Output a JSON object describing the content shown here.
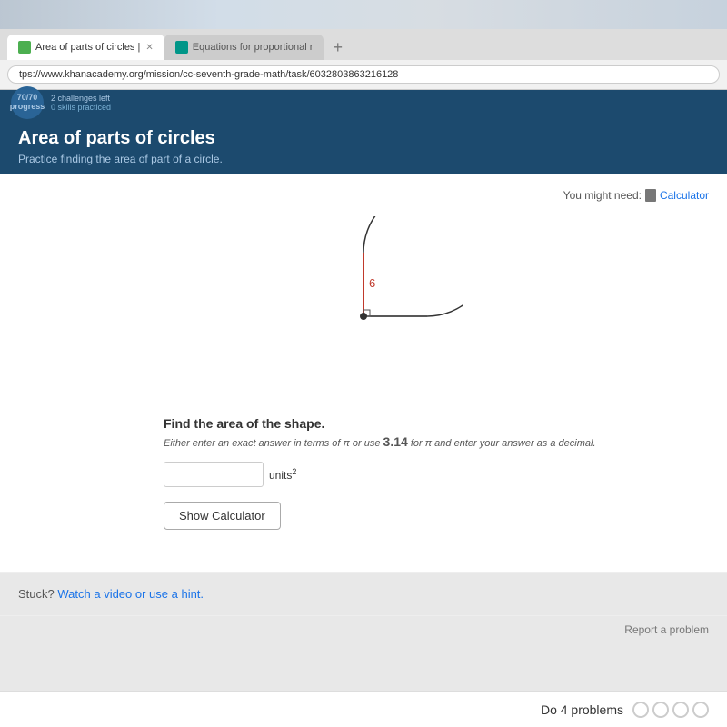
{
  "browser": {
    "tabs": [
      {
        "id": "tab1",
        "label": "Area of parts of circles |",
        "active": true,
        "favicon_color": "green"
      },
      {
        "id": "tab2",
        "label": "Equations for proportional r",
        "active": false,
        "favicon_color": "teal"
      }
    ],
    "address": "tps://www.khanacademy.org/mission/cc-seventh-grade-math/task/6032803863216128",
    "new_tab_label": "+"
  },
  "ka_header": {
    "score_label": "70",
    "score_unit": "/ 70",
    "skills_label": "0 skills practiced"
  },
  "page": {
    "title": "Area of parts of circles",
    "subtitle": "Practice finding the area of part of a circle."
  },
  "exercise": {
    "you_might_need_prefix": "You might need:",
    "calculator_label": "Calculator",
    "diagram": {
      "radius_label": "6",
      "description": "Circle with a quarter section removed (top-right quadrant visible as cut), radius shown as 6"
    },
    "question_main": "Find the area of the shape.",
    "question_sub_part1": "Either enter an exact answer in terms of π or use",
    "question_sub_pi_value": "3.14",
    "question_sub_part2": "for π and enter your answer as a decimal.",
    "answer_placeholder": "",
    "units_label": "units",
    "units_exponent": "2",
    "show_calculator_button": "Show Calculator",
    "stuck_prefix": "Stuck?",
    "stuck_link_text": "Watch a video or use a hint.",
    "report_label": "Report a problem",
    "do_problems_label": "Do 4 problems",
    "progress_circles": [
      0,
      0,
      0,
      0
    ]
  }
}
